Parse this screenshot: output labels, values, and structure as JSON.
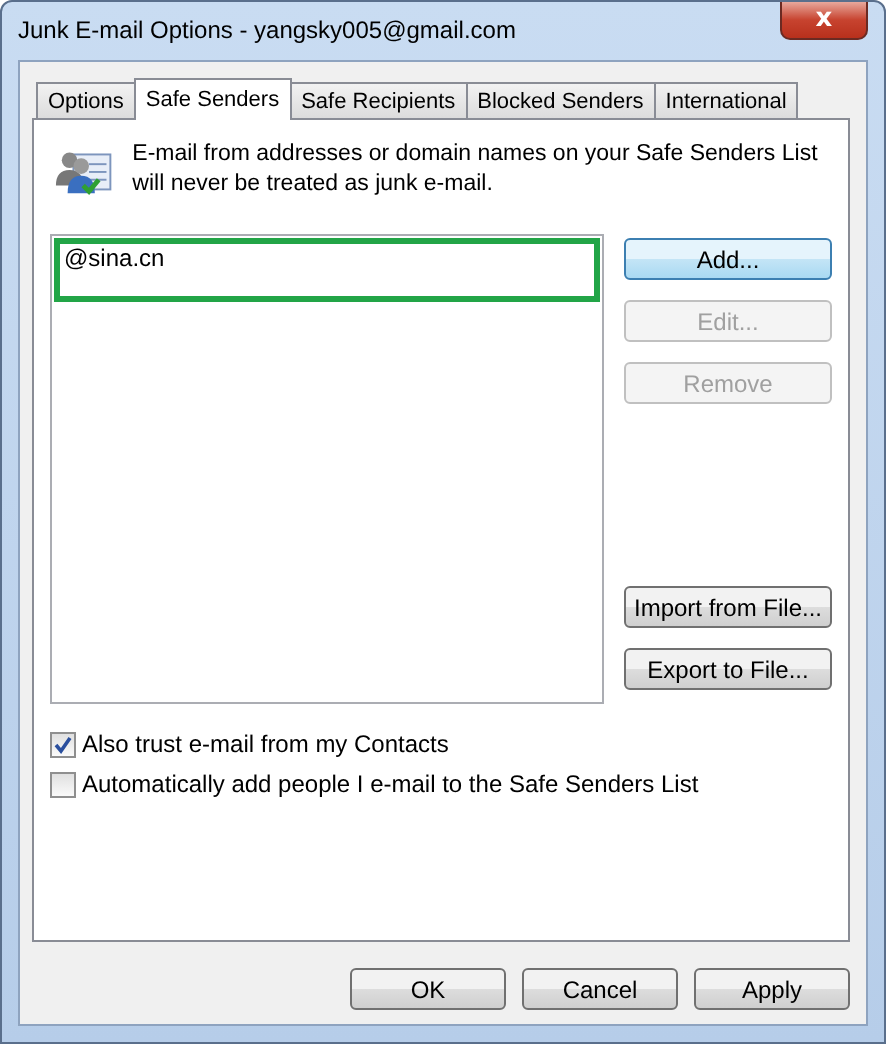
{
  "window": {
    "title": "Junk E-mail Options - yangsky005@gmail.com",
    "close_label": "x"
  },
  "tabs": [
    {
      "label": "Options",
      "selected": false
    },
    {
      "label": "Safe Senders",
      "selected": true
    },
    {
      "label": "Safe Recipients",
      "selected": false
    },
    {
      "label": "Blocked Senders",
      "selected": false
    },
    {
      "label": "International",
      "selected": false
    }
  ],
  "description": "E-mail from addresses or domain names on your Safe Senders List will never be treated as junk e-mail.",
  "list": {
    "items": [
      {
        "text": "@sina.cn",
        "highlighted": true
      }
    ]
  },
  "side_buttons": [
    {
      "label": "Add...",
      "disabled": false,
      "default": true
    },
    {
      "label": "Edit...",
      "disabled": true,
      "default": false
    },
    {
      "label": "Remove",
      "disabled": true,
      "default": false
    },
    {
      "label": "Import from File...",
      "disabled": false,
      "default": false
    },
    {
      "label": "Export to File...",
      "disabled": false,
      "default": false
    }
  ],
  "checkboxes": [
    {
      "label": "Also trust e-mail from my Contacts",
      "checked": true
    },
    {
      "label": "Automatically add people I e-mail to the Safe Senders List",
      "checked": false
    }
  ],
  "buttons": [
    {
      "label": "OK"
    },
    {
      "label": "Cancel"
    },
    {
      "label": "Apply"
    }
  ]
}
